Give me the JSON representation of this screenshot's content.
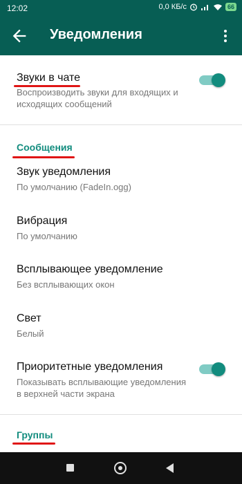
{
  "status_bar": {
    "time": "12:02",
    "network_speed": "0,0 КБ/с",
    "battery": "66"
  },
  "app_bar": {
    "title": "Уведомления"
  },
  "settings": {
    "chat_sounds": {
      "title": "Звуки в чате",
      "subtitle": "Воспроизводить звуки для входящих и исходящих сообщений",
      "enabled": true
    },
    "messages_section": {
      "header": "Сообщения",
      "notification_sound": {
        "title": "Звук уведомления",
        "value": "По умолчанию (FadeIn.ogg)"
      },
      "vibration": {
        "title": "Вибрация",
        "value": "По умолчанию"
      },
      "popup": {
        "title": "Всплывающее уведомление",
        "value": "Без всплывающих окон"
      },
      "light": {
        "title": "Свет",
        "value": "Белый"
      },
      "priority": {
        "title": "Приоритетные уведомления",
        "subtitle": "Показывать всплывающие уведомления в верхней части экрана",
        "enabled": true
      }
    },
    "groups_section": {
      "header": "Группы"
    }
  },
  "colors": {
    "app_bar": "#075E54",
    "accent": "#128C7E",
    "toggle_track": "#80cbc4",
    "annotation": "#e01515"
  },
  "icons": {
    "back": "arrow-left-icon",
    "menu": "more-vert-icon",
    "nav_recents": "square-icon",
    "nav_home": "circle-icon",
    "nav_back": "triangle-back-icon"
  }
}
